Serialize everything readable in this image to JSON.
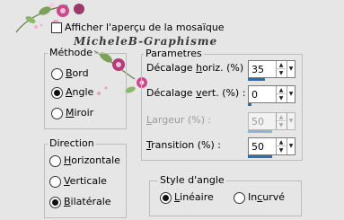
{
  "preview_checkbox": {
    "label": "Afficher l'aperçu de la mosaïque",
    "checked": false
  },
  "watermark": "MicheleB-Graphisme",
  "methode": {
    "title": "Méthode",
    "options": [
      {
        "label": "Bord",
        "underline": "B",
        "rest": "ord",
        "selected": false
      },
      {
        "label": "Angle",
        "underline": "A",
        "rest": "ngle",
        "selected": true
      },
      {
        "label": "Miroir",
        "underline": "M",
        "rest": "iroir",
        "selected": false
      }
    ]
  },
  "direction": {
    "title": "Direction",
    "options": [
      {
        "label": "Horizontale",
        "underline": "H",
        "rest": "orizontale",
        "selected": false
      },
      {
        "label": "Verticale",
        "underline": "V",
        "rest": "erticale",
        "selected": false
      },
      {
        "label": "Bilatérale",
        "underline": "B",
        "rest": "ilatérale",
        "selected": true
      }
    ]
  },
  "parametres": {
    "title": "Parametres",
    "rows": [
      {
        "pre": "Décalage ",
        "ul": "h",
        "post": "oriz. (%) :",
        "value": "35",
        "enabled": true,
        "fill": 0.35
      },
      {
        "pre": "Décalage ",
        "ul": "v",
        "post": "ert. (%) :",
        "value": "0",
        "enabled": true,
        "fill": 0.0
      },
      {
        "pre": "",
        "ul": "L",
        "post": "argeur (%) :",
        "value": "50",
        "enabled": false,
        "fill": 0.5
      },
      {
        "pre": "",
        "ul": "T",
        "post": "ransition (%) :",
        "value": "50",
        "enabled": true,
        "fill": 0.5
      }
    ]
  },
  "style_angle": {
    "title": "Style d'angle",
    "options": [
      {
        "label": "Linéaire",
        "underline": "L",
        "rest": "inéaire",
        "selected": true
      },
      {
        "label": "Incurvé",
        "pre": "In",
        "underline": "c",
        "rest": "urvé",
        "selected": false
      }
    ]
  },
  "colors": {
    "accent": "#1e73be",
    "background": "#e6e6e6"
  }
}
